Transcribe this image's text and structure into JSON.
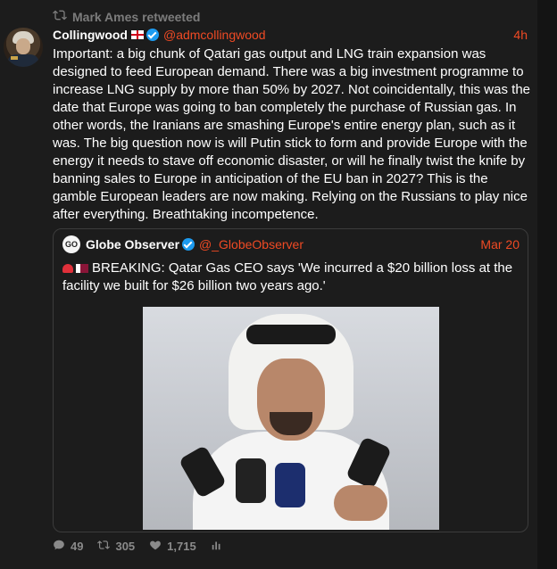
{
  "retweet": {
    "text": "Mark Ames retweeted"
  },
  "tweet": {
    "author_name": "Collingwood",
    "handle": "@admcollingwood",
    "time": "4h",
    "body": "Important: a big chunk of Qatari gas output and LNG train expansion was designed to feed European demand. There was a big investment programme to increase LNG supply by more than 50% by 2027. Not coincidentally, this was the date that Europe was going to ban completely the purchase of Russian gas. In other words, the Iranians are smashing Europe's entire energy plan, such as it was. The big question now is will Putin stick to form and provide Europe with the energy it needs to stave off economic disaster, or will he finally twist the knife by banning sales to Europe in anticipation of the EU ban in 2027? This is the gamble European leaders are now making. Relying on the Russians to play nice after everything. Breathtaking incompetence."
  },
  "quote": {
    "avatar_text": "GO",
    "author_name": "Globe Observer",
    "handle": "@_GlobeObserver",
    "time": "Mar 20",
    "body": "BREAKING: Qatar Gas CEO says 'We incurred a $20 billion loss at the facility we built for $26 billion two years ago.'"
  },
  "actions": {
    "replies": "49",
    "retweets": "305",
    "likes": "1,715"
  },
  "colors": {
    "accent": "#ef4a24",
    "verified": "#1d9bf0",
    "background": "#1c1c1c"
  }
}
